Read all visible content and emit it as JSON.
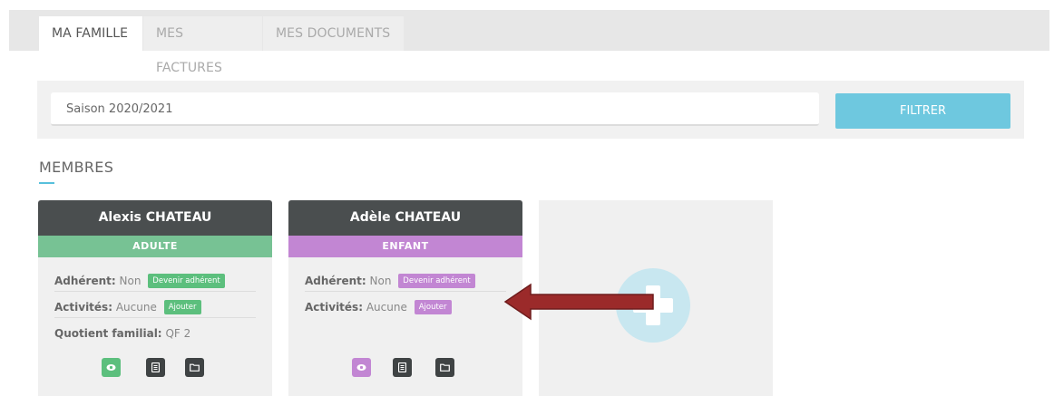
{
  "tabs": [
    {
      "label": "MA FAMILLE",
      "active": true
    },
    {
      "label": "MES FACTURES",
      "active": false
    },
    {
      "label": "MES DOCUMENTS",
      "active": false
    }
  ],
  "filter": {
    "season_value": "Saison 2020/2021",
    "button_label": "FILTRER"
  },
  "members": {
    "title": "MEMBRES",
    "cards": [
      {
        "name": "Alexis CHATEAU",
        "type": "ADULTE",
        "color": "#77c294",
        "adherent_label": "Adhérent:",
        "adherent_value": "Non",
        "adherent_button": "Devenir adhérent",
        "activities_label": "Activités:",
        "activities_value": "Aucune",
        "activities_button": "Ajouter",
        "quotient_label": "Quotient familial:",
        "quotient_value": "QF 2",
        "icons": [
          "eye-icon",
          "document-icon",
          "folder-icon"
        ]
      },
      {
        "name": "Adèle CHATEAU",
        "type": "ENFANT",
        "color": "#c286d3",
        "adherent_label": "Adhérent:",
        "adherent_value": "Non",
        "adherent_button": "Devenir adhérent",
        "activities_label": "Activités:",
        "activities_value": "Aucune",
        "activities_button": "Ajouter",
        "icons": [
          "eye-icon",
          "document-icon",
          "folder-icon"
        ]
      }
    ],
    "add_card_icon": "plus-icon"
  },
  "colors": {
    "accent": "#6ec8df",
    "header_dark": "#4a4e4f",
    "arrow": "#9b2a2a"
  }
}
